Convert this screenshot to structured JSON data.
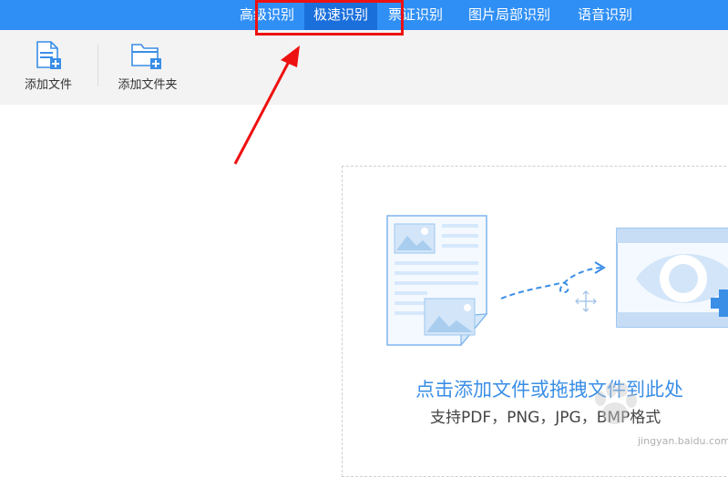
{
  "tabs": [
    {
      "label": "高级识别",
      "active": false
    },
    {
      "label": "极速识别",
      "active": true
    },
    {
      "label": "票证识别",
      "active": false
    },
    {
      "label": "图片局部识别",
      "active": false
    },
    {
      "label": "语音识别",
      "active": false
    }
  ],
  "toolbar": {
    "add_file_label": "添加文件",
    "add_folder_label": "添加文件夹"
  },
  "dropzone": {
    "title": "点击添加文件或拖拽文件到此处",
    "subtitle": "支持PDF，PNG，JPG，BMP格式"
  },
  "watermark": {
    "text": "jingyan.baidu.com"
  },
  "colors": {
    "header": "#2f8ff5",
    "active_tab": "#1a6fdb",
    "accent": "#3a8ee6",
    "annotation": "#ee1111"
  },
  "icons": [
    "add-file-icon",
    "add-folder-icon",
    "document-illustration",
    "move-icon",
    "preview-eye-illustration",
    "annotation-arrow"
  ]
}
